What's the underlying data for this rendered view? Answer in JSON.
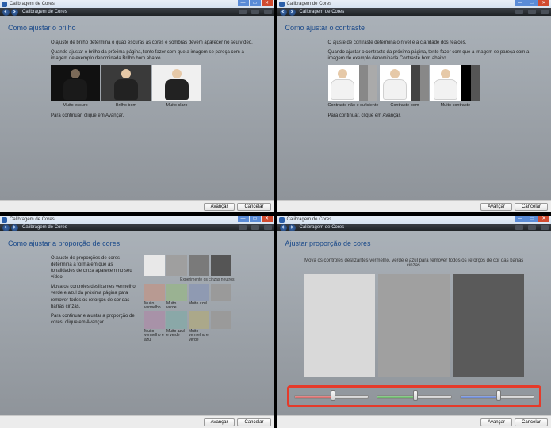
{
  "window_title": "Calibragem de Cores",
  "buttons": {
    "next": "Avançar",
    "cancel": "Cancelar"
  },
  "win": {
    "min": "—",
    "max": "▭",
    "close": "✕"
  },
  "q1": {
    "heading": "Como ajustar o brilho",
    "p1": "O ajuste de brilho determina o quão escuras as cores e sombras devem aparecer no seu vídeo.",
    "p2": "Quando ajustar o brilho da próxima página, tente fazer com que a imagem se pareça com a imagem de exemplo denominada Brilho bom abaixo.",
    "p3": "Para continuar, clique em Avançar.",
    "caps": [
      "Muito escuro",
      "Brilho bom",
      "Muito claro"
    ]
  },
  "q2": {
    "heading": "Como ajustar o contraste",
    "p1": "O ajuste de contraste determina o nível e a claridade dos realces.",
    "p2": "Quando ajustar o contraste da próxima página, tente fazer com que a imagem se pareça com a imagem de exemplo denominada Contraste bom abaixo.",
    "p3": "Para continuar, clique em Avançar.",
    "caps": [
      "Contraste não é suficiente",
      "Contraste bom",
      "Muito contraste"
    ]
  },
  "q3": {
    "heading": "Como ajustar a proporção de cores",
    "p1": "O ajuste de proporções de cores determina a forma em que as tonalidades de cinza aparecem no seu vídeo.",
    "p2": "Mova os controles deslizantes vermelho, verde e azul da próxima página para remover todos os reforços de cor das barras cinzas.",
    "p3": "Para continuar e ajustar a proporção de cores, clique em Avançar.",
    "hint": "Experimente os cinzas neutros:",
    "swcaps": [
      "Muito vermelho",
      "Muito verde",
      "Muito azul",
      "",
      "Muito vermelho e azul",
      "Muito azul e verde",
      "Muito vermelho e verde",
      ""
    ]
  },
  "q4": {
    "heading": "Ajustar proporção de cores",
    "p1": "Mova os controles deslizantes vermelho, verde e azul para remover todos os reforços de cor das barras cinzas."
  }
}
